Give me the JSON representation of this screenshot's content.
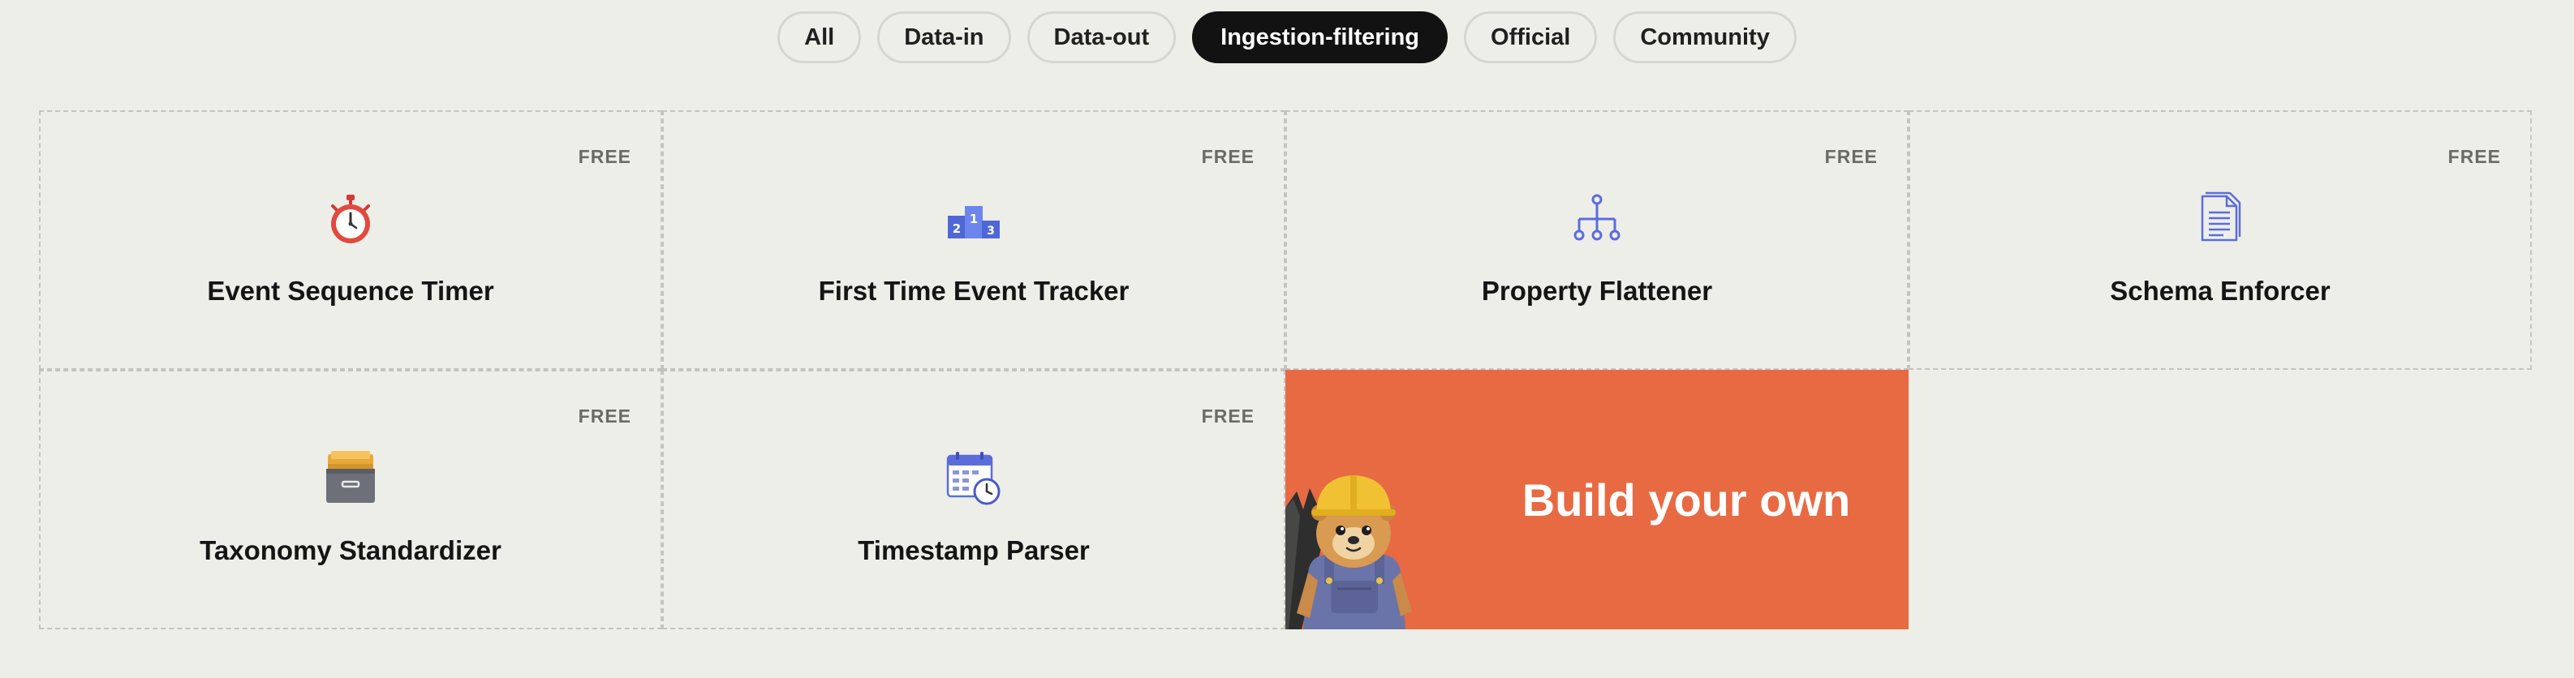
{
  "filters": [
    {
      "label": "All",
      "active": false
    },
    {
      "label": "Data-in",
      "active": false
    },
    {
      "label": "Data-out",
      "active": false
    },
    {
      "label": "Ingestion-filtering",
      "active": true
    },
    {
      "label": "Official",
      "active": false
    },
    {
      "label": "Community",
      "active": false
    }
  ],
  "cards": [
    {
      "title": "Event Sequence Timer",
      "badge": "FREE",
      "icon": "stopwatch-icon"
    },
    {
      "title": "First Time Event Tracker",
      "badge": "FREE",
      "icon": "podium-icon"
    },
    {
      "title": "Property Flattener",
      "badge": "FREE",
      "icon": "hierarchy-icon"
    },
    {
      "title": "Schema Enforcer",
      "badge": "FREE",
      "icon": "document-icon"
    },
    {
      "title": "Taxonomy Standardizer",
      "badge": "FREE",
      "icon": "file-cabinet-icon"
    },
    {
      "title": "Timestamp Parser",
      "badge": "FREE",
      "icon": "calendar-clock-icon"
    }
  ],
  "cta": {
    "label": "Build your own",
    "background": "#e76a43",
    "illustration": "hedgehog-builder-mascot"
  },
  "colors": {
    "page_background": "#eeeee9",
    "active_pill": "#121212",
    "icon_blue": "#5b6ddb",
    "stopwatch_red": "#e04a3f"
  }
}
